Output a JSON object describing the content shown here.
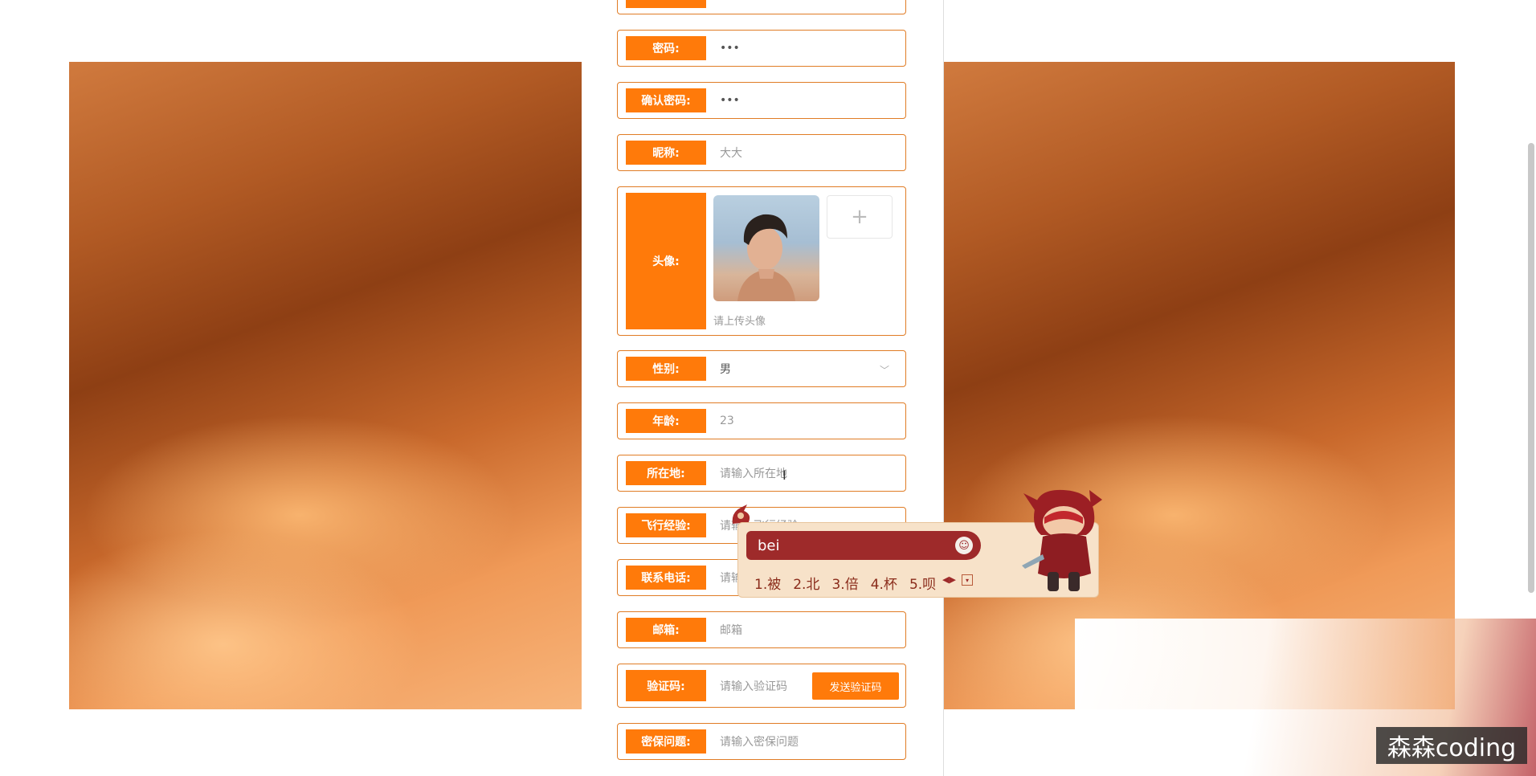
{
  "form": {
    "fields": [
      {
        "label": "",
        "value": ""
      },
      {
        "label": "密码:",
        "value": "•••"
      },
      {
        "label": "确认密码:",
        "value": "•••"
      },
      {
        "label": "昵称:",
        "value": "大大"
      },
      {
        "label": "头像:",
        "hint": "请上传头像",
        "upload_icon": "plus-icon"
      },
      {
        "label": "性别:",
        "value": "男",
        "icon": "chevron-down-icon"
      },
      {
        "label": "年龄:",
        "value": "23"
      },
      {
        "label": "所在地:",
        "placeholder": "请输入所在地"
      },
      {
        "label": "飞行经验:",
        "placeholder": "请输入飞行经验"
      },
      {
        "label": "联系电话:",
        "placeholder": "请输入联系电话"
      },
      {
        "label": "邮箱:",
        "placeholder": "邮箱"
      },
      {
        "label": "验证码:",
        "placeholder": "请输入验证码",
        "button": "发送验证码"
      },
      {
        "label": "密保问题:",
        "placeholder": "请输入密保问题"
      }
    ]
  },
  "ime": {
    "input": "bei",
    "candidates": [
      "1.被",
      "2.北",
      "3.倍",
      "4.杯",
      "5.呗"
    ],
    "arrows": "◀▶",
    "menu_icon": "dropdown-icon"
  },
  "watermark": "森森coding",
  "colors": {
    "accent": "#ff7a0a",
    "border": "#e07c25",
    "ime_bar": "#9e2a2a"
  }
}
